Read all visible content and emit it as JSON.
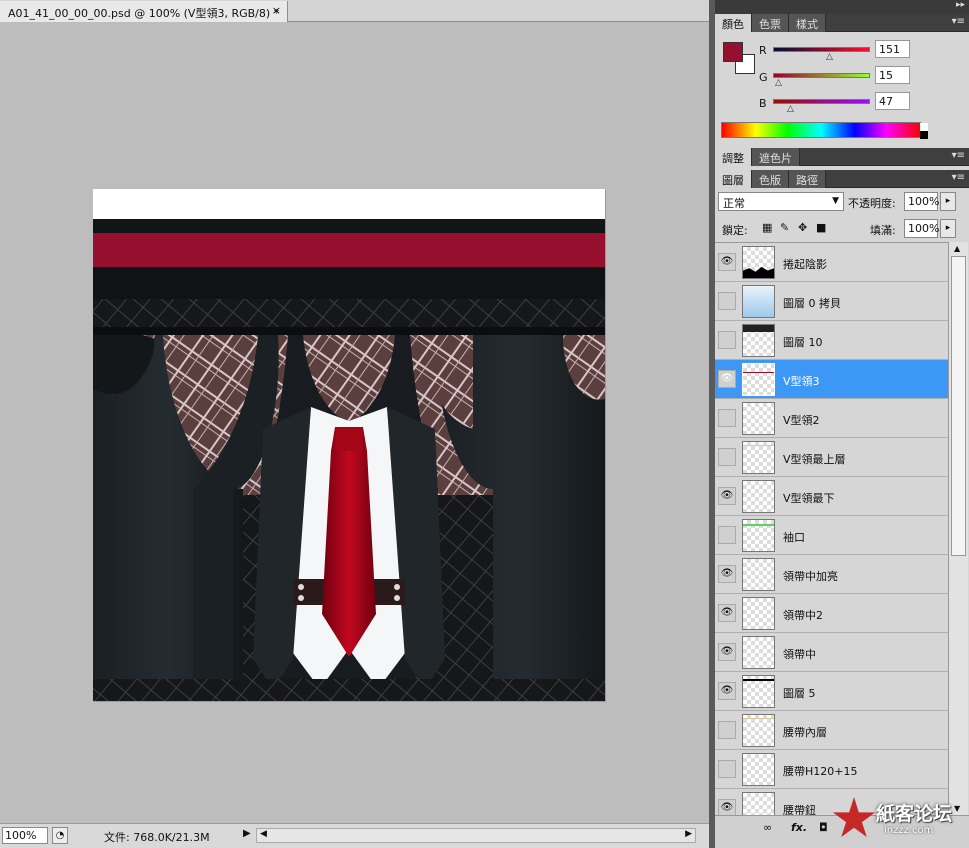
{
  "document": {
    "tab_title": "A01_41_00_00_00.psd @ 100% (V型領3, RGB/8) *",
    "close_glyph": "×"
  },
  "status_bar": {
    "zoom": "100%",
    "doc_info": "文件: 768.0K/21.3M",
    "arrow_glyph": "▶"
  },
  "panel_strip": {
    "collapse_glyph": "▸▸"
  },
  "color_panel": {
    "tabs": [
      "顏色",
      "色票",
      "樣式"
    ],
    "menu_glyph": "▾≡",
    "foreground_color": "#970F2F",
    "background_color": "#FFFFFF",
    "channels": [
      {
        "label": "R",
        "value": "151"
      },
      {
        "label": "G",
        "value": "15"
      },
      {
        "label": "B",
        "value": "47"
      }
    ]
  },
  "adjust_panel": {
    "tabs": [
      "調整",
      "遮色片"
    ],
    "menu_glyph": "▾≡"
  },
  "layers_panel": {
    "tabs": [
      "圖層",
      "色版",
      "路徑"
    ],
    "menu_glyph": "▾≡",
    "blend_mode": "正常",
    "opacity_label": "不透明度:",
    "opacity_value": "100%",
    "lock_label": "鎖定:",
    "fill_label": "填滿:",
    "fill_value": "100%",
    "layers": [
      {
        "name": "捲起陰影",
        "visible": true,
        "selected": false,
        "thumb": "shadow"
      },
      {
        "name": "圖層 0 拷貝",
        "visible": false,
        "selected": false,
        "thumb": "blue"
      },
      {
        "name": "圖層 10",
        "visible": false,
        "selected": false,
        "thumb": "darktop"
      },
      {
        "name": "V型領3",
        "visible": true,
        "selected": true,
        "thumb": "redline"
      },
      {
        "name": "V型領2",
        "visible": false,
        "selected": false,
        "thumb": "blank"
      },
      {
        "name": "V型領最上層",
        "visible": false,
        "selected": false,
        "thumb": "tanline"
      },
      {
        "name": "V型領最下",
        "visible": true,
        "selected": false,
        "thumb": "blank"
      },
      {
        "name": "袖口",
        "visible": false,
        "selected": false,
        "thumb": "greenline"
      },
      {
        "name": "領帶中加亮",
        "visible": true,
        "selected": false,
        "thumb": "blank"
      },
      {
        "name": "領帶中2",
        "visible": true,
        "selected": false,
        "thumb": "blank"
      },
      {
        "name": "領帶中",
        "visible": true,
        "selected": false,
        "thumb": "blank"
      },
      {
        "name": "圖層 5",
        "visible": true,
        "selected": false,
        "thumb": "blackline"
      },
      {
        "name": "腰帶內層",
        "visible": false,
        "selected": false,
        "thumb": "tanline"
      },
      {
        "name": "腰帶H120+15",
        "visible": false,
        "selected": false,
        "thumb": "blank"
      },
      {
        "name": "腰帶鈕",
        "visible": true,
        "selected": false,
        "thumb": "blank"
      }
    ]
  },
  "watermark": {
    "text": "紙客论坛",
    "url": "inzzz.com"
  }
}
